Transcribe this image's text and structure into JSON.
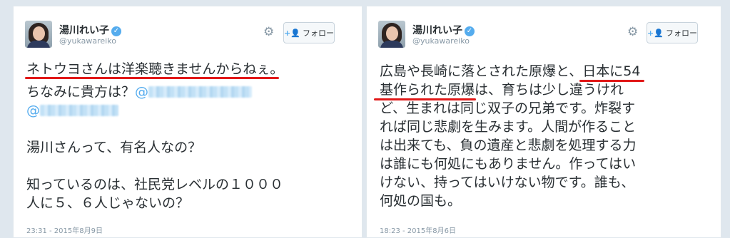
{
  "left_tweet": {
    "user_name": "湯川れい子",
    "user_handle": "@yukawareiko",
    "follow_label": "フォロー",
    "lines": {
      "line1": "ネトウヨさんは洋楽聴きませんからねぇ。",
      "line2_text": "ちなみに貴方は？",
      "line2_mention": "@",
      "line3_mention": "@",
      "line4": "湯川さんって、有名人なの？",
      "line5": "知っているのは、社民党レベルの１０００",
      "line6": "人に５、６人じゃないの？"
    },
    "timestamp": "23:31 - 2015年8月9日"
  },
  "right_tweet": {
    "user_name": "湯川れい子",
    "user_handle": "@yukawareiko",
    "follow_label": "フォロー",
    "lines": {
      "line1_a": "広島や長崎に落とされた原爆と、",
      "line1_b": "日本に54",
      "line2_a": "基作られた原爆",
      "line2_b": "は、育ちは少し違うけれ",
      "line3": "ど、生まれは同じ双子の兄弟です。炸裂す",
      "line4": "れば同じ悲劇を生みます。人間が作ること",
      "line5": "は出来ても、負の遺産と悲劇を処理する力",
      "line6": "は誰にも何処にもありません。作ってはい",
      "line7": "けない、持ってはいけない物です。誰も、",
      "line8": "何処の国も。"
    },
    "timestamp": "18:23 - 2015年8月6日"
  },
  "icons": {
    "verified": "verified-badge-icon",
    "settings": "gear-icon",
    "follow": "add-user-icon"
  },
  "colors": {
    "link_blue": "#55acee",
    "highlight_red": "#e11818",
    "text": "#292f33",
    "meta_gray": "#8899a6"
  }
}
